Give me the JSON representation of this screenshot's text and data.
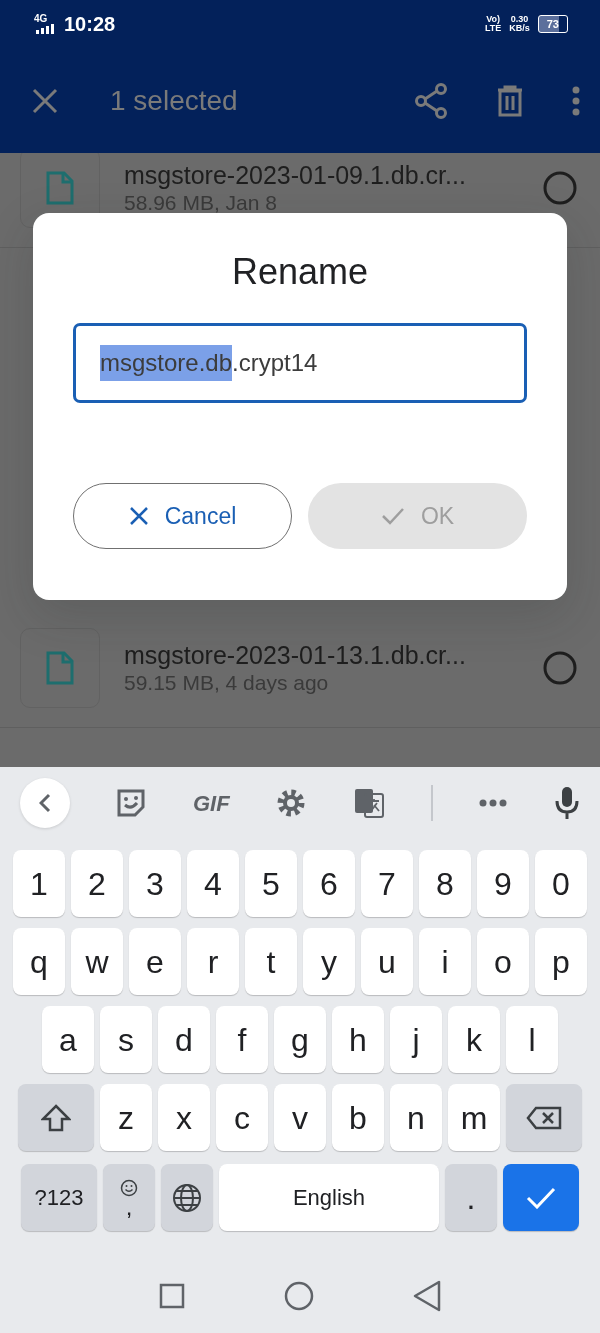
{
  "status_bar": {
    "network": "4G",
    "time": "10:28",
    "volte_top": "Vo)",
    "volte_bottom": "LTE",
    "speed": "0.30",
    "speed_unit": "KB/s",
    "battery": "73"
  },
  "app_bar": {
    "title": "1 selected"
  },
  "files": [
    {
      "name": "msgstore-2023-01-09.1.db.cr...",
      "meta": "58.96 MB, Jan 8",
      "selected": false
    },
    {
      "name": "msgstore-2023-01-13.1.db.cr...",
      "meta": "59.15 MB, 4 days ago",
      "selected": false
    }
  ],
  "dialog": {
    "title": "Rename",
    "value_selected": "msgstore.db",
    "value_rest": ".crypt14",
    "buttons": [
      {
        "label": "Cancel",
        "kind": "cancel",
        "disabled": false
      },
      {
        "label": "OK",
        "kind": "ok",
        "disabled": true
      }
    ]
  },
  "keyboard": {
    "toolbar": [
      {
        "kind": "back"
      },
      {
        "kind": "sticker"
      },
      {
        "kind": "gif",
        "label": "GIF"
      },
      {
        "kind": "settings"
      },
      {
        "kind": "translate"
      },
      {
        "kind": "divider"
      },
      {
        "kind": "more"
      },
      {
        "kind": "mic"
      }
    ],
    "rows": [
      [
        {
          "kind": "char",
          "label": "1"
        },
        {
          "kind": "char",
          "label": "2"
        },
        {
          "kind": "char",
          "label": "3"
        },
        {
          "kind": "char",
          "label": "4"
        },
        {
          "kind": "char",
          "label": "5"
        },
        {
          "kind": "char",
          "label": "6"
        },
        {
          "kind": "char",
          "label": "7"
        },
        {
          "kind": "char",
          "label": "8"
        },
        {
          "kind": "char",
          "label": "9"
        },
        {
          "kind": "char",
          "label": "0"
        }
      ],
      [
        {
          "kind": "char",
          "label": "q"
        },
        {
          "kind": "char",
          "label": "w"
        },
        {
          "kind": "char",
          "label": "e"
        },
        {
          "kind": "char",
          "label": "r"
        },
        {
          "kind": "char",
          "label": "t"
        },
        {
          "kind": "char",
          "label": "y"
        },
        {
          "kind": "char",
          "label": "u"
        },
        {
          "kind": "char",
          "label": "i"
        },
        {
          "kind": "char",
          "label": "o"
        },
        {
          "kind": "char",
          "label": "p"
        }
      ],
      [
        {
          "kind": "char",
          "label": "a"
        },
        {
          "kind": "char",
          "label": "s"
        },
        {
          "kind": "char",
          "label": "d"
        },
        {
          "kind": "char",
          "label": "f"
        },
        {
          "kind": "char",
          "label": "g"
        },
        {
          "kind": "char",
          "label": "h"
        },
        {
          "kind": "char",
          "label": "j"
        },
        {
          "kind": "char",
          "label": "k"
        },
        {
          "kind": "char",
          "label": "l"
        }
      ],
      [
        {
          "kind": "shift"
        },
        {
          "kind": "char",
          "label": "z"
        },
        {
          "kind": "char",
          "label": "x"
        },
        {
          "kind": "char",
          "label": "c"
        },
        {
          "kind": "char",
          "label": "v"
        },
        {
          "kind": "char",
          "label": "b"
        },
        {
          "kind": "char",
          "label": "n"
        },
        {
          "kind": "char",
          "label": "m"
        },
        {
          "kind": "backspace"
        }
      ]
    ],
    "bottom_row": [
      {
        "kind": "symbols",
        "label": "?123"
      },
      {
        "kind": "emoji",
        "label": ","
      },
      {
        "kind": "globe"
      },
      {
        "kind": "space",
        "label": "English"
      },
      {
        "kind": "char",
        "label": "."
      },
      {
        "kind": "enter"
      }
    ]
  },
  "nav_bar": [
    {
      "kind": "recents"
    },
    {
      "kind": "home"
    },
    {
      "kind": "back"
    }
  ]
}
